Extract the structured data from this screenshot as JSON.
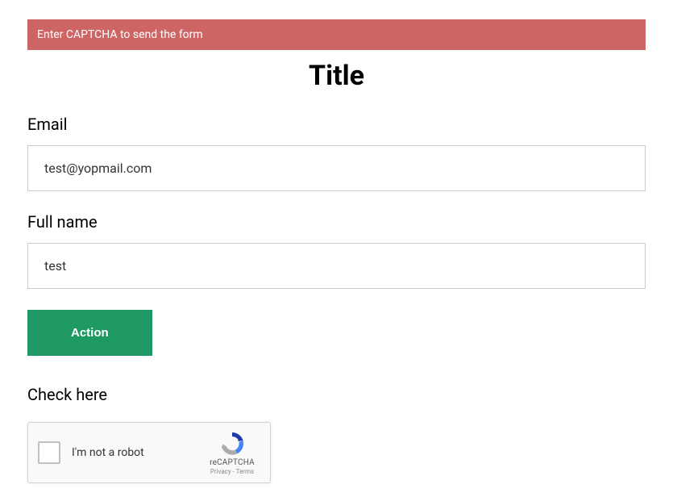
{
  "alert": {
    "message": "Enter CAPTCHA to send the form"
  },
  "header": {
    "title": "Title"
  },
  "form": {
    "email": {
      "label": "Email",
      "value": "test@yopmail.com"
    },
    "fullname": {
      "label": "Full name",
      "value": "test"
    },
    "action_label": "Action"
  },
  "captcha": {
    "label": "Check here",
    "widget_text": "I'm not a robot",
    "brand": "reCAPTCHA",
    "links": "Privacy - Terms"
  }
}
